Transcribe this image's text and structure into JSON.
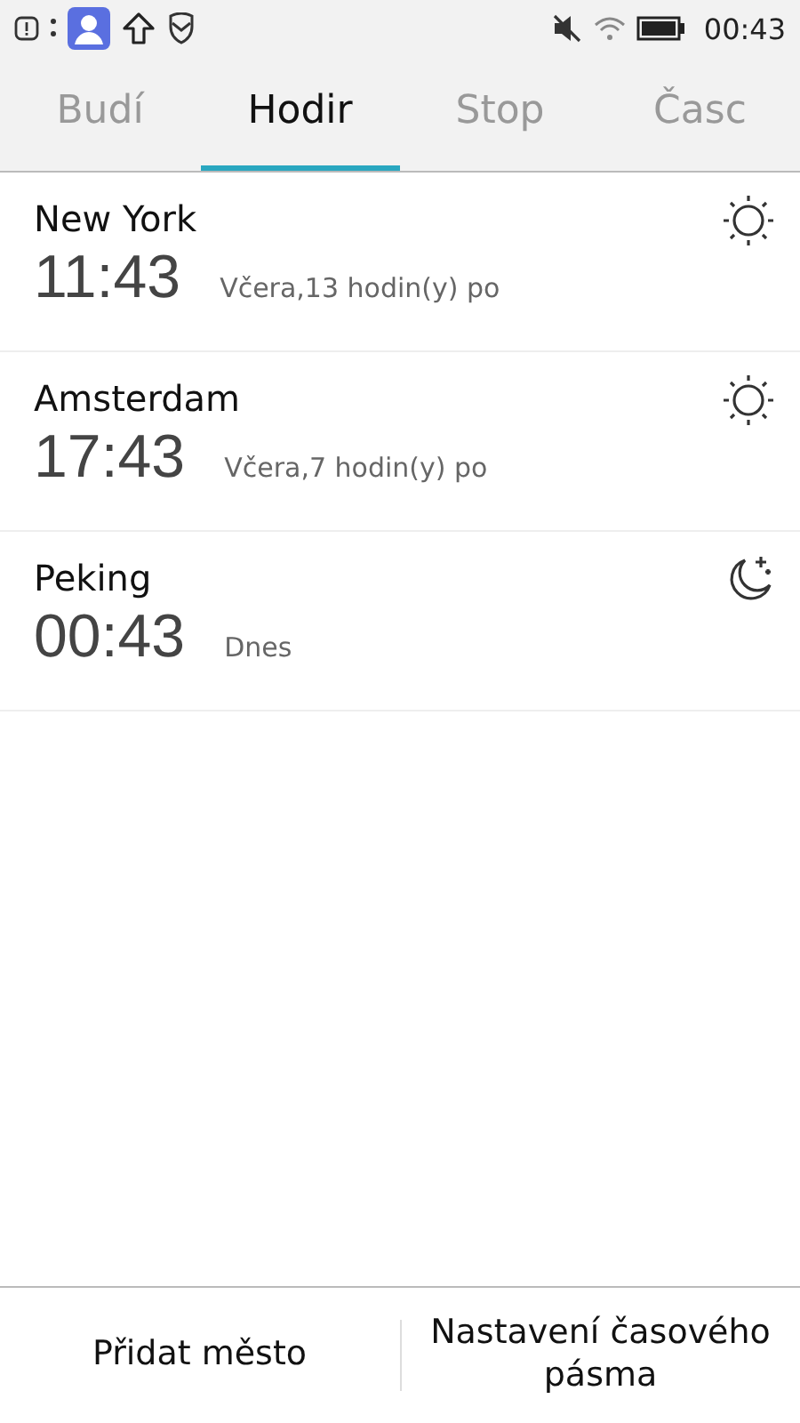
{
  "status_bar": {
    "time": "00:43"
  },
  "tabs": [
    {
      "label": "Budí",
      "selected": false
    },
    {
      "label": "Hodir",
      "selected": true
    },
    {
      "label": "Stop",
      "selected": false
    },
    {
      "label": "Časc",
      "selected": false
    }
  ],
  "cities": [
    {
      "name": "New York",
      "time": "11:43",
      "offset": "Včera,13 hodin(y) po",
      "kind": "day"
    },
    {
      "name": "Amsterdam",
      "time": "17:43",
      "offset": "Včera,7 hodin(y) po",
      "kind": "day"
    },
    {
      "name": "Peking",
      "time": "00:43",
      "offset": "Dnes",
      "kind": "night"
    }
  ],
  "buttons": [
    "Přidat město",
    "Nastavení časového pásma"
  ]
}
